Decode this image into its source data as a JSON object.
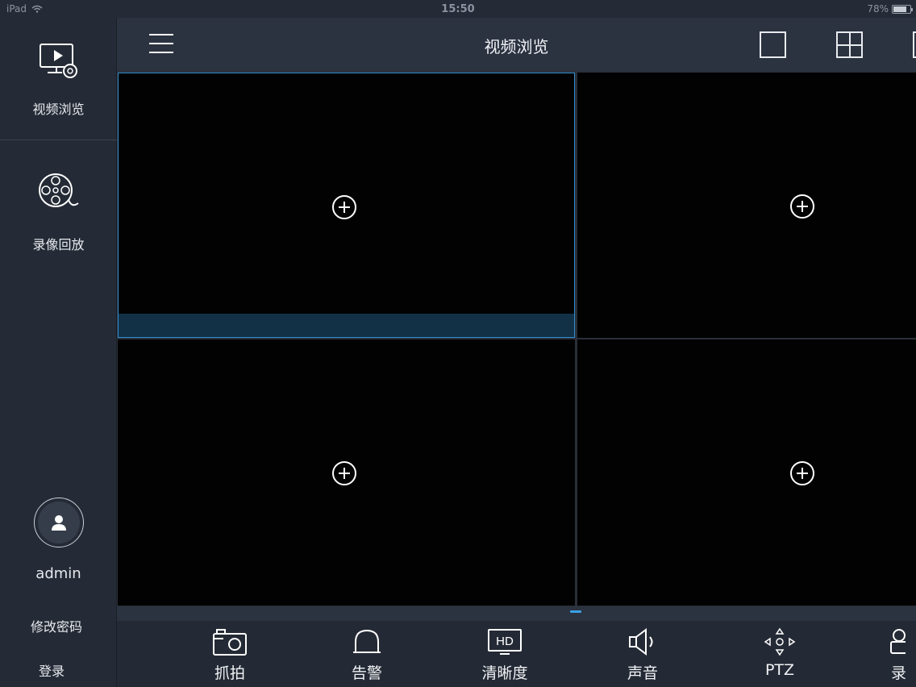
{
  "status_bar": {
    "carrier": "iPad",
    "time": "15:50",
    "battery": "78%",
    "battery_level": 0.78
  },
  "sidebar": {
    "items": [
      {
        "label": "视频浏览",
        "icon": "monitor-play-icon"
      },
      {
        "label": "录像回放",
        "icon": "film-reel-icon"
      }
    ],
    "user": {
      "avatar_icon": "user-avatar-icon",
      "name": "admin"
    },
    "change_password": "修改密码",
    "login": "登录"
  },
  "header": {
    "title": "视频浏览",
    "menu_icon": "hamburger-menu-icon",
    "layouts": [
      "layout-single-icon",
      "layout-quad-icon",
      "layout-nine-icon"
    ]
  },
  "video_grid": {
    "cells": [
      {
        "selected": true,
        "icon": "add-camera-icon"
      },
      {
        "selected": false,
        "icon": "add-camera-icon"
      },
      {
        "selected": false,
        "icon": "add-camera-icon"
      },
      {
        "selected": false,
        "icon": "add-camera-icon"
      }
    ]
  },
  "toolbar": {
    "items": [
      {
        "label": "抓拍",
        "icon": "camera-icon"
      },
      {
        "label": "告警",
        "icon": "alarm-siren-icon"
      },
      {
        "label": "清晰度",
        "icon": "hd-icon"
      },
      {
        "label": "声音",
        "icon": "speaker-icon"
      },
      {
        "label": "PTZ",
        "icon": "ptz-directions-icon"
      },
      {
        "label": "录",
        "icon": "record-icon"
      }
    ],
    "hd_badge": "HD"
  },
  "colors": {
    "accent": "#2f8fd1",
    "background": "#1e2430",
    "sidebar": "#252b36"
  }
}
